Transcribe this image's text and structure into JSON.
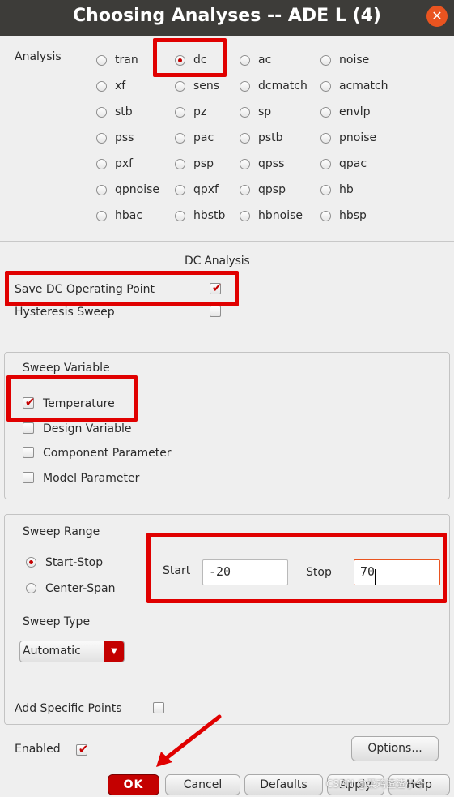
{
  "window": {
    "title": "Choosing Analyses -- ADE L (4)",
    "close_glyph": "✕"
  },
  "analysis": {
    "label": "Analysis",
    "selected": "dc",
    "options": [
      "tran",
      "dc",
      "ac",
      "noise",
      "xf",
      "sens",
      "dcmatch",
      "acmatch",
      "stb",
      "pz",
      "sp",
      "envlp",
      "pss",
      "pac",
      "pstb",
      "pnoise",
      "pxf",
      "psp",
      "qpss",
      "qpac",
      "qpnoise",
      "qpxf",
      "qpsp",
      "hb",
      "hbac",
      "hbstb",
      "hbnoise",
      "hbsp"
    ]
  },
  "dc_analysis": {
    "header": "DC Analysis",
    "save_dc_op": {
      "label": "Save DC Operating Point",
      "checked": true
    },
    "hysteresis": {
      "label": "Hysteresis Sweep",
      "checked": false
    }
  },
  "sweep_variable": {
    "header": "Sweep Variable",
    "items": [
      {
        "label": "Temperature",
        "checked": true
      },
      {
        "label": "Design Variable",
        "checked": false
      },
      {
        "label": "Component Parameter",
        "checked": false
      },
      {
        "label": "Model Parameter",
        "checked": false
      }
    ]
  },
  "sweep_range": {
    "header": "Sweep Range",
    "start_stop_label": "Start-Stop",
    "center_span_label": "Center-Span",
    "selected": "Start-Stop",
    "start_label": "Start",
    "start_value": "-20",
    "stop_label": "Stop",
    "stop_value": "70"
  },
  "sweep_type": {
    "header": "Sweep Type",
    "value": "Automatic"
  },
  "add_specific_points": {
    "label": "Add Specific Points",
    "checked": false
  },
  "enabled": {
    "label": "Enabled",
    "checked": true
  },
  "buttons": {
    "options": "Options...",
    "ok": "OK",
    "cancel": "Cancel",
    "defaults": "Defaults",
    "apply": "Apply",
    "help": "Help"
  },
  "watermark": "CSDN @菜鸡渣渣小个",
  "colors": {
    "highlight_red": "#e00000",
    "title_bar": "#3d3c39",
    "check_red": "#c40000"
  },
  "icons": {
    "check": "✔",
    "arrow": "red-arrow-annotation",
    "dropdown": "▼"
  }
}
